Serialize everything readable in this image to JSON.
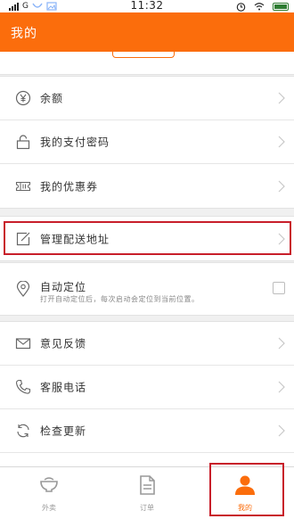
{
  "status_bar": {
    "network": "G",
    "time": "11:32"
  },
  "header": {
    "title": "我的"
  },
  "group1": [
    {
      "label": "余额",
      "icon": "yen-circle-icon"
    },
    {
      "label": "我的支付密码",
      "icon": "lock-icon"
    },
    {
      "label": "我的优惠券",
      "icon": "ticket-icon"
    }
  ],
  "group2": [
    {
      "label": "管理配送地址",
      "icon": "edit-icon"
    }
  ],
  "group3": {
    "label": "自动定位",
    "sub": "打开自动定位后，每次启动会定位到当前位置。",
    "icon": "location-pin-icon",
    "checked": false
  },
  "group4": [
    {
      "label": "意见反馈",
      "icon": "mail-icon"
    },
    {
      "label": "客服电话",
      "icon": "phone-icon"
    },
    {
      "label": "检查更新",
      "icon": "refresh-icon"
    }
  ],
  "tabs": [
    {
      "label": "外卖",
      "icon": "bowl-icon",
      "active": false
    },
    {
      "label": "订单",
      "icon": "document-icon",
      "active": false
    },
    {
      "label": "我的",
      "icon": "person-icon",
      "active": true
    }
  ],
  "colors": {
    "brand": "#fb6d0c",
    "highlight": "#c81e2a"
  }
}
